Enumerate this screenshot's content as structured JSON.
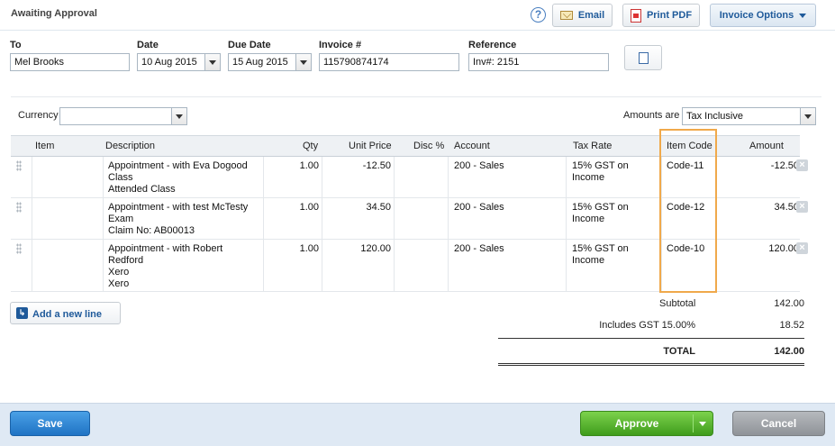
{
  "header": {
    "status": "Awaiting Approval",
    "email_label": "Email",
    "print_pdf_label": "Print PDF",
    "invoice_options_label": "Invoice Options"
  },
  "form": {
    "to_label": "To",
    "to_value": "Mel Brooks",
    "date_label": "Date",
    "date_value": "10 Aug 2015",
    "due_date_label": "Due Date",
    "due_date_value": "15 Aug 2015",
    "invoice_no_label": "Invoice #",
    "invoice_no_value": "115790874174",
    "reference_label": "Reference",
    "reference_value": "Inv#: 2151",
    "currency_label": "Currency",
    "currency_value": "",
    "amounts_are_label": "Amounts are",
    "amounts_are_value": "Tax Inclusive"
  },
  "table": {
    "headers": {
      "item": "Item",
      "description": "Description",
      "qty": "Qty",
      "unit_price": "Unit Price",
      "disc": "Disc %",
      "account": "Account",
      "tax_rate": "Tax Rate",
      "item_code": "Item Code",
      "amount": "Amount"
    },
    "rows": [
      {
        "desc1": "Appointment - with Eva Dogood",
        "desc2": "Class",
        "desc3": "Attended Class",
        "qty": "1.00",
        "unit_price": "-12.50",
        "account": "200 - Sales",
        "tax1": "15% GST on",
        "tax2": "Income",
        "item_code": "Code-11",
        "amount": "-12.50"
      },
      {
        "desc1": "Appointment - with test McTesty",
        "desc2": "Exam",
        "desc3": "Claim No: AB00013",
        "qty": "1.00",
        "unit_price": "34.50",
        "account": "200 - Sales",
        "tax1": "15% GST on",
        "tax2": "Income",
        "item_code": "Code-12",
        "amount": "34.50"
      },
      {
        "desc1": "Appointment - with Robert",
        "desc2": "Redford",
        "desc3": "Xero",
        "desc4": "Xero",
        "qty": "1.00",
        "unit_price": "120.00",
        "account": "200 - Sales",
        "tax1": "15% GST on",
        "tax2": "Income",
        "item_code": "Code-10",
        "amount": "120.00"
      }
    ]
  },
  "add_line_label": "Add a new line",
  "totals": {
    "subtotal_label": "Subtotal",
    "subtotal_value": "142.00",
    "gst_label": "Includes GST 15.00%",
    "gst_value": "18.52",
    "total_label": "TOTAL",
    "total_value": "142.00"
  },
  "footer": {
    "save_label": "Save",
    "approve_label": "Approve",
    "cancel_label": "Cancel"
  },
  "colors": {
    "highlight": "#f0a94b",
    "save": "#1f73c4",
    "approve": "#3f9c1c",
    "cancel": "#8f9398"
  }
}
